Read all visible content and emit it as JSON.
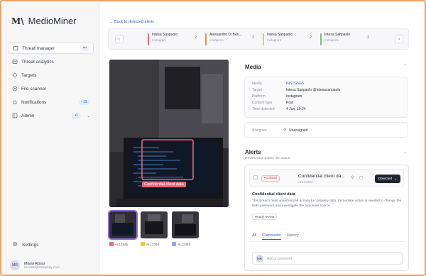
{
  "app": {
    "logo": "M\\",
    "name": "MedioMiner"
  },
  "sidebar": {
    "items": [
      {
        "label": "Threat manager",
        "badge": "•••",
        "icon": "shield-icon"
      },
      {
        "label": "Threat analytics",
        "icon": "chart-icon"
      },
      {
        "label": "Targets",
        "icon": "target-icon"
      },
      {
        "label": "File scanner",
        "icon": "file-icon"
      },
      {
        "label": "Notifications",
        "badge": "• 18",
        "icon": "bell-icon"
      },
      {
        "label": "Admin",
        "badge": "•1",
        "icon": "admin-icon"
      }
    ],
    "settings_label": "Settings",
    "user": {
      "initials": "MR",
      "name": "Mario Rossi",
      "email": "m.rossi@company.com"
    }
  },
  "header": {
    "back_link": "← Back to detected alerts",
    "carousel": [
      {
        "title": "Intesa Sanpaolo",
        "sub": "Instagram",
        "num": "2",
        "color": "#e86a7a"
      },
      {
        "title": "Alessandro Di Ben...",
        "sub": "Instagram",
        "num": "2",
        "color": "#e8953a"
      },
      {
        "title": "Intesa Sanpaolo",
        "sub": "Instagram",
        "num": "2",
        "color": "#e8cf3a"
      },
      {
        "title": "Intesa Sanpaolo",
        "sub": "Instagram",
        "num": "2",
        "color": "#7cc46a"
      }
    ]
  },
  "image": {
    "detection_label": "Confidential client data",
    "thumbs": [
      {
        "tag": "AL12345",
        "color": "#e86a7a"
      },
      {
        "tag": "AL12345",
        "color": "#e8cf3a"
      },
      {
        "tag": "AL12345",
        "color": "#8fa8e8"
      }
    ]
  },
  "media": {
    "title": "Media",
    "fields": [
      {
        "label": "Media",
        "value": "INSTG5G5",
        "link": true
      },
      {
        "label": "Target",
        "value": "Intesa Sanpaolo @intesasanpaolo"
      },
      {
        "label": "Platform",
        "value": "Instagram"
      },
      {
        "label": "Content type",
        "value": "Post"
      },
      {
        "label": "Time detected",
        "value": "4 Jun, 10:24"
      }
    ],
    "assignee_label": "Assignee",
    "assignee_value": "Unassigned"
  },
  "alerts": {
    "title": "Alerts",
    "subtitle": "Review and update the status",
    "card": {
      "severity": "• Critical",
      "title": "Confidential client da...",
      "id": "AL123451",
      "status": "Detected",
      "desc_title": "Confidential client data",
      "desc_text": "This breach risks unauthorized access to company data. Immediate action is needed to change the WiFi password and investigate the exposure source.",
      "ready_label": "Ready review",
      "tabs": [
        "All",
        "Comments",
        "History"
      ],
      "comment_initials": "MR",
      "comment_placeholder": "Add a comment"
    }
  },
  "colors": {
    "accent": "#3a5bd0",
    "critical": "#d34b5c",
    "selected_thumb": "#8a6fd8"
  }
}
